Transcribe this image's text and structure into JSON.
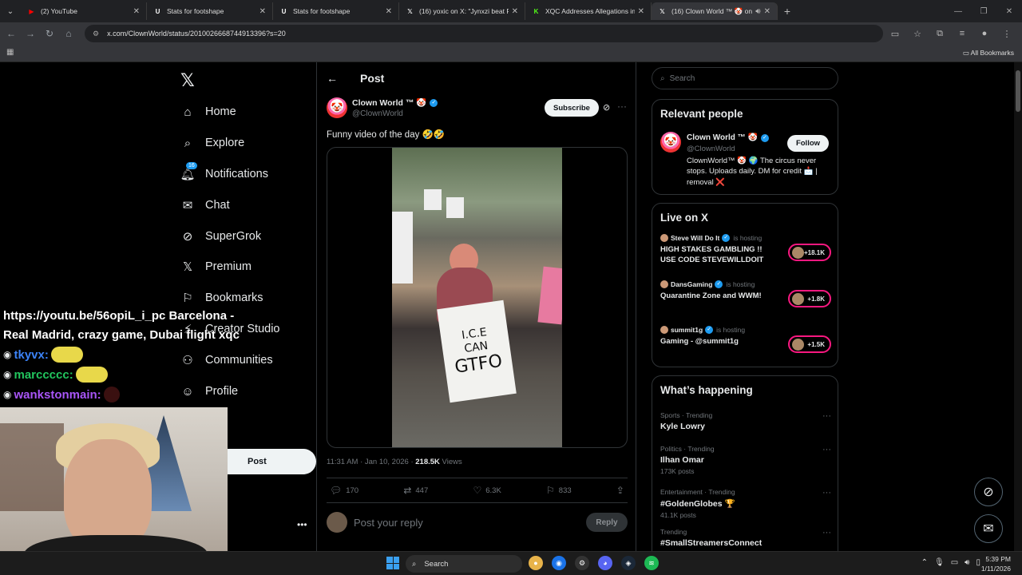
{
  "browser": {
    "tabs": [
      {
        "title": "(2) YouTube",
        "favicon": "youtube-icon",
        "color": "#ff0000"
      },
      {
        "title": "Stats for footshape",
        "favicon": "stats-icon",
        "color": "#ffffff"
      },
      {
        "title": "Stats for footshape",
        "favicon": "stats-icon",
        "color": "#ffffff"
      },
      {
        "title": "(16) yoxic on X: \"Jynxzi beat Ro",
        "favicon": "x-icon",
        "color": "#ffffff"
      },
      {
        "title": "XQC Addresses Allegations in L",
        "favicon": "kick-icon",
        "color": "#53fc18"
      },
      {
        "title": "(16) Clown World ™ 🤡 on",
        "favicon": "x-icon",
        "color": "#ffffff",
        "active": true
      }
    ],
    "url": "x.com/ClownWorld/status/2010026668744913396?s=20",
    "all_bookmarks": "All Bookmarks"
  },
  "nav": {
    "items": [
      {
        "label": "Home",
        "icon": "home-icon"
      },
      {
        "label": "Explore",
        "icon": "search-icon"
      },
      {
        "label": "Notifications",
        "icon": "bell-icon",
        "badge": "16"
      },
      {
        "label": "Chat",
        "icon": "mail-icon"
      },
      {
        "label": "SuperGrok",
        "icon": "grok-icon"
      },
      {
        "label": "Premium",
        "icon": "x-icon"
      },
      {
        "label": "Bookmarks",
        "icon": "bookmark-icon"
      },
      {
        "label": "Creator Studio",
        "icon": "creator-icon"
      },
      {
        "label": "Communities",
        "icon": "communities-icon"
      },
      {
        "label": "Profile",
        "icon": "profile-icon"
      }
    ],
    "post_button": "Post"
  },
  "post": {
    "header": "Post",
    "author_name": "Clown World ™ 🤡",
    "author_handle": "@ClownWorld",
    "subscribe": "Subscribe",
    "text": "Funny video of the day 🤣🤣",
    "sign_line1": "I.C.E",
    "sign_line2": "CAN",
    "sign_line3": "GTFO",
    "time": "11:31 AM · Jan 10, 2026 · ",
    "views_count": "218.5K",
    "views_label": " Views",
    "replies": "170",
    "reposts": "447",
    "likes": "6.3K",
    "bookmarks": "833",
    "reply_placeholder": "Post your reply",
    "reply_button": "Reply"
  },
  "right": {
    "search_placeholder": "Search",
    "relevant_title": "Relevant people",
    "person_name": "Clown World ™ 🤡",
    "person_handle": "@ClownWorld",
    "follow": "Follow",
    "person_bio": "ClownWorld™ 🤡 🌍 The circus never stops. Uploads daily. DM for credit 📩 | removal ❌",
    "live_title": "Live on X",
    "live": [
      {
        "host": "Steve Will Do It",
        "status": "is hosting",
        "title": "HIGH STAKES GAMBLING !! USE CODE STEVEWILLDOIT",
        "count": "+18.1K"
      },
      {
        "host": "DansGaming",
        "status": "is hosting",
        "title": "Quarantine Zone and WWM!",
        "count": "+1.8K"
      },
      {
        "host": "summit1g",
        "status": "is hosting",
        "title": "Gaming - @summit1g",
        "count": "+1.5K"
      }
    ],
    "happening_title": "What’s happening",
    "trends": [
      {
        "category": "Sports · Trending",
        "name": "Kyle Lowry",
        "count": ""
      },
      {
        "category": "Politics · Trending",
        "name": "Ilhan Omar",
        "count": "173K posts"
      },
      {
        "category": "Entertainment · Trending",
        "name": "#GoldenGlobes 🏆",
        "count": "41.1K posts"
      },
      {
        "category": "Trending",
        "name": "#SmallStreamersConnect",
        "count": ""
      }
    ]
  },
  "overlay": {
    "link_text": "https://youtu.be/56opiL_i_pc Barcelona - Real Madrid, crazy game, Dubai flight xqc",
    "chat": [
      {
        "user": "tkyvx:",
        "color": "#3b82f6"
      },
      {
        "user": "marccccc:",
        "color": "#22c55e"
      },
      {
        "user": "wankstonmain:",
        "color": "#a855f7"
      }
    ]
  },
  "taskbar": {
    "search": "Search",
    "time": "5:39 PM",
    "date": "1/11/2026"
  }
}
